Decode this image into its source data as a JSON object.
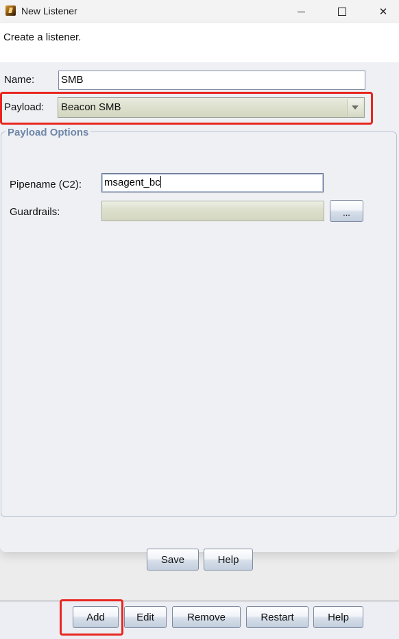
{
  "window": {
    "title": "New Listener",
    "minimize_icon": "minimize-icon",
    "maximize_icon": "maximize-icon",
    "close_icon": "close-icon",
    "close_glyph": "✕"
  },
  "description": "Create a listener.",
  "form": {
    "name_label": "Name:",
    "name_value": "SMB",
    "payload_label": "Payload:",
    "payload_value": "Beacon SMB"
  },
  "payload_options": {
    "legend": "Payload Options",
    "pipename_label": "Pipename (C2):",
    "pipename_value": "msagent_bc",
    "guardrails_label": "Guardrails:",
    "guardrails_value": "",
    "browse_label": "..."
  },
  "dialog_buttons": {
    "save": "Save",
    "help": "Help"
  },
  "main_buttons": {
    "add": "Add",
    "edit": "Edit",
    "remove": "Remove",
    "restart": "Restart",
    "help": "Help"
  },
  "highlight_color": "#e8261f"
}
